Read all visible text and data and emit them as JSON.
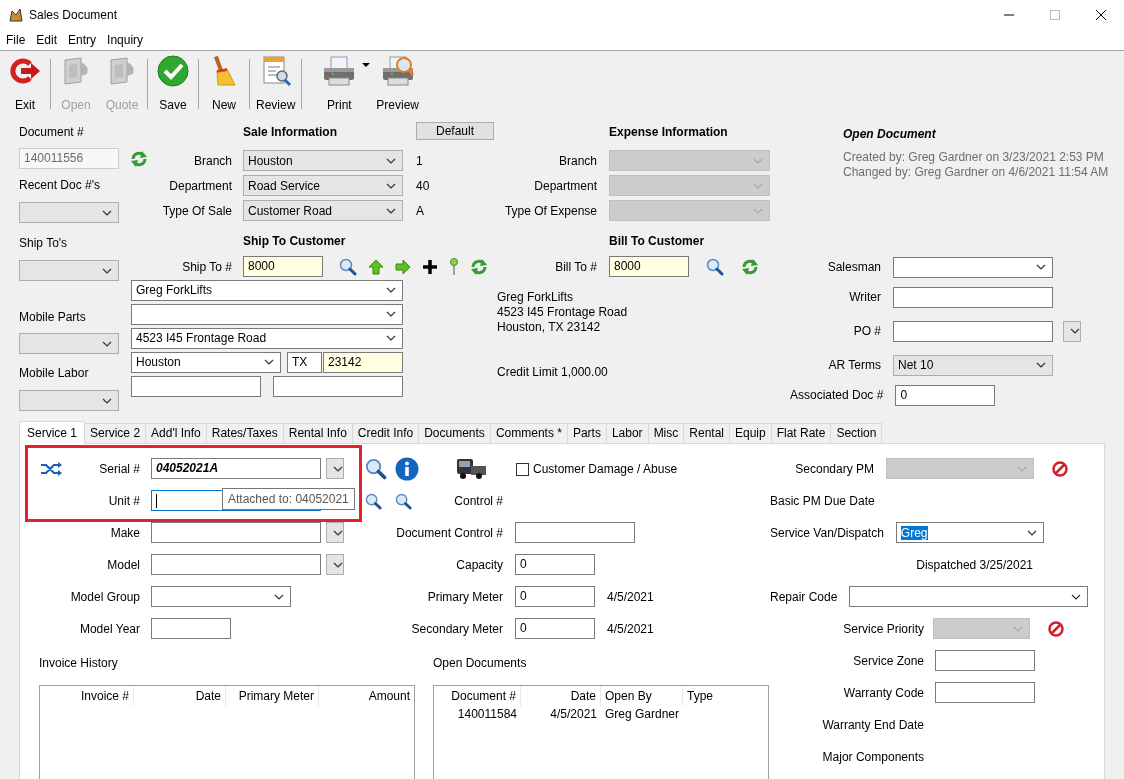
{
  "window": {
    "title": "Sales Document"
  },
  "menu": [
    "File",
    "Edit",
    "Entry",
    "Inquiry"
  ],
  "toolbar": [
    {
      "label": "Exit",
      "disabled": false,
      "dropdown": false
    },
    {
      "label": "Open",
      "disabled": true,
      "dropdown": false
    },
    {
      "label": "Quote",
      "disabled": true,
      "dropdown": false
    },
    {
      "label": "Save",
      "disabled": false,
      "dropdown": false
    },
    {
      "label": "New",
      "disabled": false,
      "dropdown": false
    },
    {
      "label": "Review",
      "disabled": false,
      "dropdown": false
    },
    {
      "label": "Print",
      "disabled": false,
      "dropdown": true
    },
    {
      "label": "Preview",
      "disabled": false,
      "dropdown": false
    }
  ],
  "document": {
    "label": "Document #",
    "value": "140011556",
    "disabled": true
  },
  "side_combos": [
    {
      "label": "Recent Doc #'s"
    },
    {
      "label": "Ship To's"
    },
    {
      "label": "Mobile Parts"
    },
    {
      "label": "Mobile Labor"
    }
  ],
  "sale_information": {
    "title": "Sale Information",
    "default_button": "Default",
    "rows": [
      {
        "label": "Branch",
        "value": "Houston",
        "code": "1",
        "disabled": false
      },
      {
        "label": "Department",
        "value": "Road Service",
        "code": "40",
        "disabled": false
      },
      {
        "label": "Type Of Sale",
        "value": "Customer Road",
        "code": "A",
        "disabled": false
      }
    ]
  },
  "expense_information": {
    "title": "Expense Information",
    "rows": [
      {
        "label": "Branch",
        "disabled": true
      },
      {
        "label": "Department",
        "disabled": true
      },
      {
        "label": "Type Of Expense",
        "disabled": true
      }
    ]
  },
  "ship_to_customer": {
    "title": "Ship To Customer",
    "number_label": "Ship To #",
    "number": "8000",
    "name": "Greg ForkLifts",
    "street": "4523 I45 Frontage Road",
    "city": "Houston",
    "state": "TX",
    "zip": "23142"
  },
  "bill_to_customer": {
    "title": "Bill To Customer",
    "number_label": "Bill To #",
    "number": "8000",
    "address": [
      "Greg ForkLifts",
      "4523 I45 Frontage Road",
      "Houston, TX  23142"
    ],
    "credit_limit": "Credit Limit 1,000.00"
  },
  "document_status": {
    "title": "Open Document",
    "created": "Created by: Greg Gardner on 3/23/2021 2:53 PM",
    "changed": "Changed by: Greg Gardner on 4/6/2021 11:54 AM"
  },
  "header_fields": [
    {
      "kind": "combo",
      "label": "Salesman",
      "disabled": false
    },
    {
      "kind": "field",
      "label": "Writer"
    },
    {
      "kind": "field-dropdown",
      "label": "PO #"
    },
    {
      "kind": "droplist",
      "label": "AR Terms",
      "value": "Net 10",
      "disabled": false
    },
    {
      "kind": "short-field",
      "label": "Associated Doc #",
      "value": "0"
    }
  ],
  "tabs": [
    {
      "label": "Service 1",
      "selected": true
    },
    {
      "label": "Service 2",
      "selected": false
    },
    {
      "label": "Add'l Info",
      "selected": false
    },
    {
      "label": "Rates/Taxes",
      "selected": false
    },
    {
      "label": "Rental Info",
      "selected": false
    },
    {
      "label": "Credit Info",
      "selected": false
    },
    {
      "label": "Documents",
      "selected": false
    },
    {
      "label": "Comments *",
      "selected": false
    },
    {
      "label": "Parts",
      "selected": false
    },
    {
      "label": "Labor",
      "selected": false
    },
    {
      "label": "Misc",
      "selected": false
    },
    {
      "label": "Rental",
      "selected": false
    },
    {
      "label": "Equip",
      "selected": false
    },
    {
      "label": "Flat Rate",
      "selected": false
    },
    {
      "label": "Section",
      "selected": false
    }
  ],
  "service": {
    "serial": {
      "label": "Serial #",
      "value": "04052021A"
    },
    "unit": {
      "label": "Unit #",
      "tooltip": "Attached to: 04052021"
    },
    "left_fields": [
      {
        "kind": "field-dropdown",
        "label": "Make"
      },
      {
        "kind": "field-dropdown",
        "label": "Model"
      },
      {
        "kind": "combo",
        "label": "Model Group"
      },
      {
        "kind": "short-field",
        "label": "Model Year"
      }
    ],
    "customer_damage": {
      "label": "Customer Damage / Abuse",
      "checked": false
    },
    "control_label": "Control #",
    "middle_fields": [
      {
        "kind": "field",
        "label": "Document Control #"
      },
      {
        "kind": "short-field",
        "label": "Capacity",
        "value": "0"
      },
      {
        "kind": "short-field",
        "label": "Primary Meter",
        "value": "0",
        "date": "4/5/2021"
      },
      {
        "kind": "short-field",
        "label": "Secondary Meter",
        "value": "0",
        "date": "4/5/2021"
      }
    ],
    "right_fields": [
      {
        "kind": "combo-clear",
        "label": "Secondary PM",
        "disabled": true
      },
      {
        "kind": "label",
        "label": "Basic PM Due Date"
      },
      {
        "kind": "combo",
        "label": "Service Van/Dispatch",
        "value": "Greg",
        "disabled": false,
        "value_selected": true
      },
      {
        "kind": "note",
        "text": "Dispatched 3/25/2021"
      },
      {
        "kind": "wide-combo",
        "label": "Repair Code",
        "disabled": false
      },
      {
        "kind": "combo-clear",
        "label": "Service Priority",
        "disabled": true
      },
      {
        "kind": "field",
        "label": "Service Zone"
      },
      {
        "kind": "field",
        "label": "Warranty Code"
      },
      {
        "kind": "label",
        "label": "Warranty End Date"
      },
      {
        "kind": "label",
        "label": "Major Components"
      }
    ],
    "invoice_history": {
      "title": "Invoice History",
      "columns": [
        "Invoice #",
        "Date",
        "Primary Meter",
        "Amount"
      ]
    },
    "open_documents": {
      "title": "Open Documents",
      "columns": [
        "Document #",
        "Date",
        "Open By",
        "Type"
      ],
      "rows": [
        [
          "140011584",
          "4/5/2021",
          "Greg Gardner"
        ]
      ]
    }
  },
  "highlight": {
    "kind": "rectangle"
  }
}
